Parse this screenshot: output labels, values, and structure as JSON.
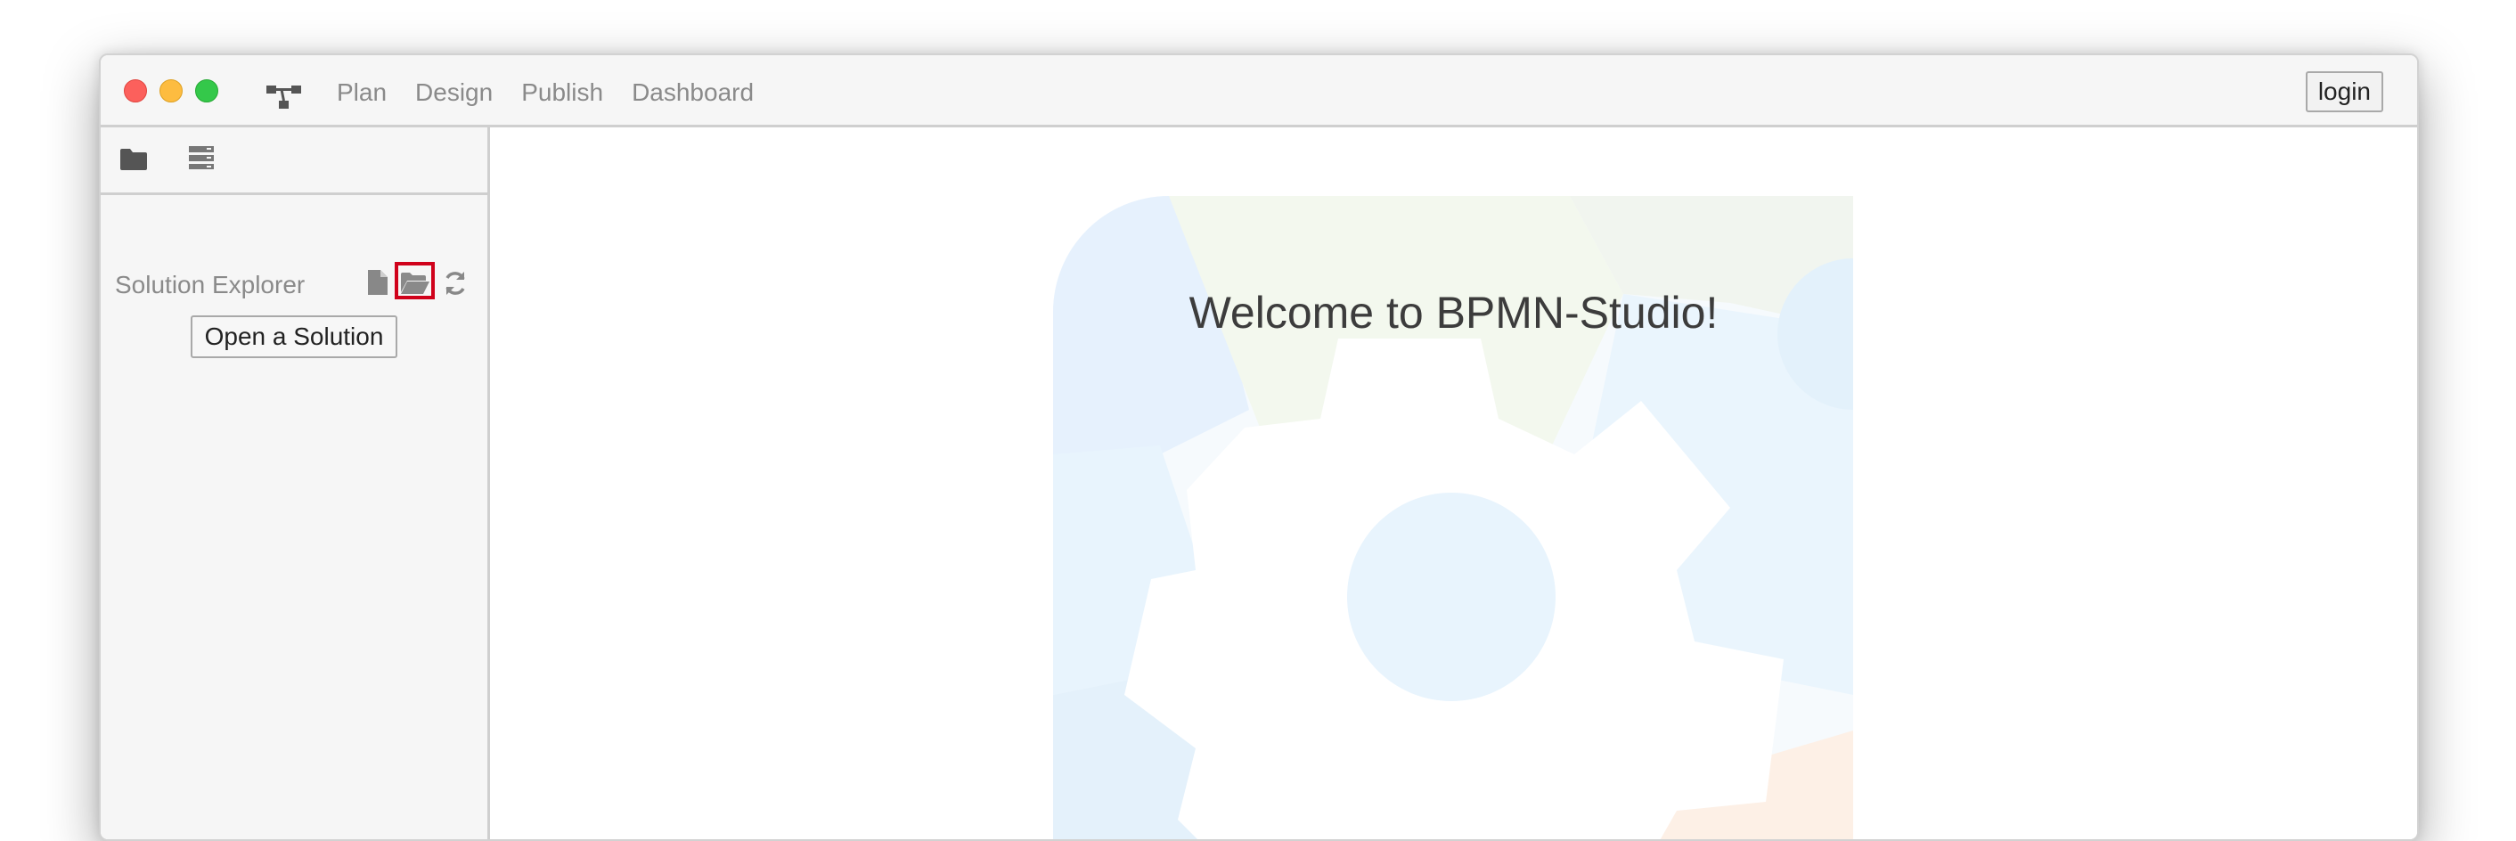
{
  "titlebar": {
    "app_icon": "hierarchy-logo-icon",
    "nav": [
      "Plan",
      "Design",
      "Publish",
      "Dashboard"
    ],
    "login_label": "login"
  },
  "sidebar": {
    "toolbar_icons": [
      "folder-icon",
      "server-icon"
    ],
    "explorer": {
      "title": "Solution Explorer",
      "actions": [
        "new-file-icon",
        "open-folder-icon",
        "refresh-icon"
      ],
      "highlighted_action": "open-folder-icon"
    },
    "open_solution_label": "Open a Solution"
  },
  "main": {
    "welcome_text": "Welcome to BPMN-Studio!",
    "background_art": "gear-watermark"
  },
  "colors": {
    "titlebar_bg": "#f6f6f6",
    "highlight": "#d0021b",
    "nav_text": "#8a8a8a",
    "welcome_text": "#3c3c3c"
  }
}
